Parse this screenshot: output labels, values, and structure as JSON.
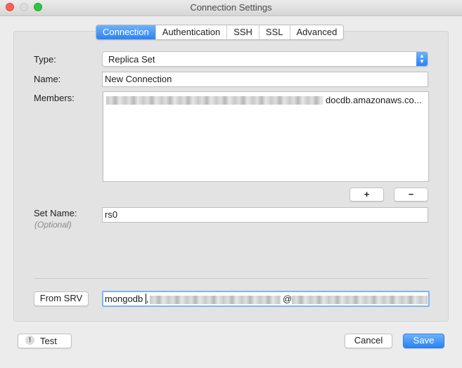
{
  "window": {
    "title": "Connection Settings"
  },
  "tabs": [
    {
      "label": "Connection",
      "active": true
    },
    {
      "label": "Authentication",
      "active": false
    },
    {
      "label": "SSH",
      "active": false
    },
    {
      "label": "SSL",
      "active": false
    },
    {
      "label": "Advanced",
      "active": false
    }
  ],
  "form": {
    "type_label": "Type:",
    "type_value": "Replica Set",
    "name_label": "Name:",
    "name_value": "New Connection",
    "members_label": "Members:",
    "members_value_visible": "docdb.amazonaws.co...",
    "add_label": "+",
    "remove_label": "−",
    "set_name_label": "Set Name:",
    "set_name_sub": "(Optional)",
    "set_name_value": "rs0",
    "from_srv_label": "From SRV",
    "srv_prefix": "mongodb",
    "srv_separator": ",",
    "srv_at": "@"
  },
  "footer": {
    "test_label": "Test",
    "test_icon": "!",
    "cancel_label": "Cancel",
    "save_label": "Save"
  },
  "colors": {
    "accent": "#2c82f3",
    "focus": "#7db3f3"
  }
}
